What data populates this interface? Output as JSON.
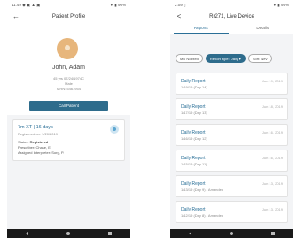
{
  "left_phone": {
    "status": {
      "time": "11:49",
      "icons": "◆ ▣ ▲ ▣",
      "signal": "▼ ▮ 96%"
    },
    "appbar": {
      "back": "←",
      "title": "Patient Profile"
    },
    "patient": {
      "name": "John, Adam",
      "dob": "45 yrs 07/24/1974C",
      "sex": "Male",
      "mrn": "MRN: 5461954"
    },
    "call_button": "Call Patient",
    "card": {
      "rx": "7m XT | 16 days",
      "registered": "Registered on: 1/20/2019",
      "status_label": "Status:",
      "status_value": "Registered",
      "prescriber_label": "Prescriber:",
      "prescriber_value": "Chase, E.",
      "interpreter_label": "Assigned Interpreter:",
      "interpreter_value": "Sorg, P."
    }
  },
  "right_phone": {
    "status": {
      "time": "2:09",
      "icons": "▯",
      "signal": "▼ ▮ 95%"
    },
    "appbar": {
      "back": "<",
      "title": "Rr271, Live Device"
    },
    "tabs": [
      {
        "label": "Reports",
        "active": true
      },
      {
        "label": "Details",
        "active": false
      }
    ],
    "filters": [
      {
        "label": "MD Notified",
        "active": false
      },
      {
        "label": "Report type: Daily ▾",
        "active": true
      },
      {
        "label": "Sort: Nev",
        "active": false
      }
    ],
    "reports": [
      {
        "title": "Daily Report",
        "sub": "1/19/19 (Day 14)",
        "date": "Jun 19, 2019"
      },
      {
        "title": "Daily Report",
        "sub": "1/17/19 (Day 13)",
        "date": "Jun 18, 2019"
      },
      {
        "title": "Daily Report",
        "sub": "1/16/19 (Day 12)",
        "date": "Jun 16, 2019"
      },
      {
        "title": "Daily Report",
        "sub": "1/15/19 (Day 11)",
        "date": "Jun 16, 2019"
      },
      {
        "title": "Daily Report",
        "sub": "1/13/19 (Day 9) - Amended",
        "date": "Jun 13, 2019"
      },
      {
        "title": "Daily Report",
        "sub": "1/12/19 (Day 8) - Amended",
        "date": "Jun 13, 2019"
      }
    ]
  },
  "colors": {
    "accent": "#2a6f97",
    "button": "#2e6c8c",
    "avatar": "#e7b67c"
  }
}
